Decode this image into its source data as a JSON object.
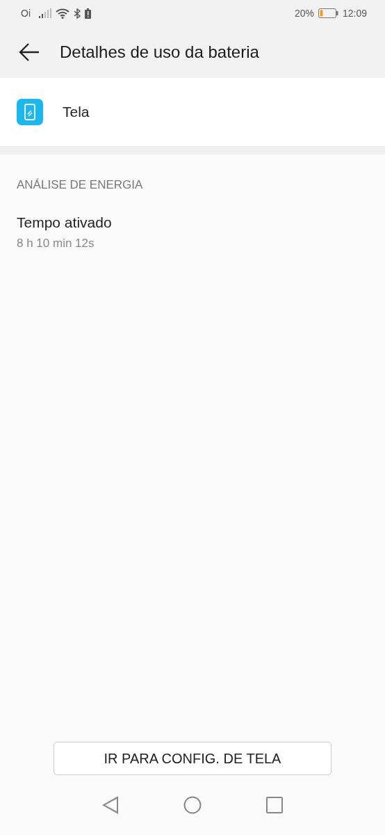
{
  "status_bar": {
    "carrier": "Oi",
    "battery": "20%",
    "time": "12:09"
  },
  "header": {
    "title": "Detalhes de uso da bateria"
  },
  "app": {
    "name": "Tela"
  },
  "section": {
    "heading": "ANÁLISE DE ENERGIA",
    "items": [
      {
        "label": "Tempo ativado",
        "value": "8 h 10 min 12s"
      }
    ]
  },
  "button": {
    "label": "IR PARA CONFIG. DE TELA"
  }
}
